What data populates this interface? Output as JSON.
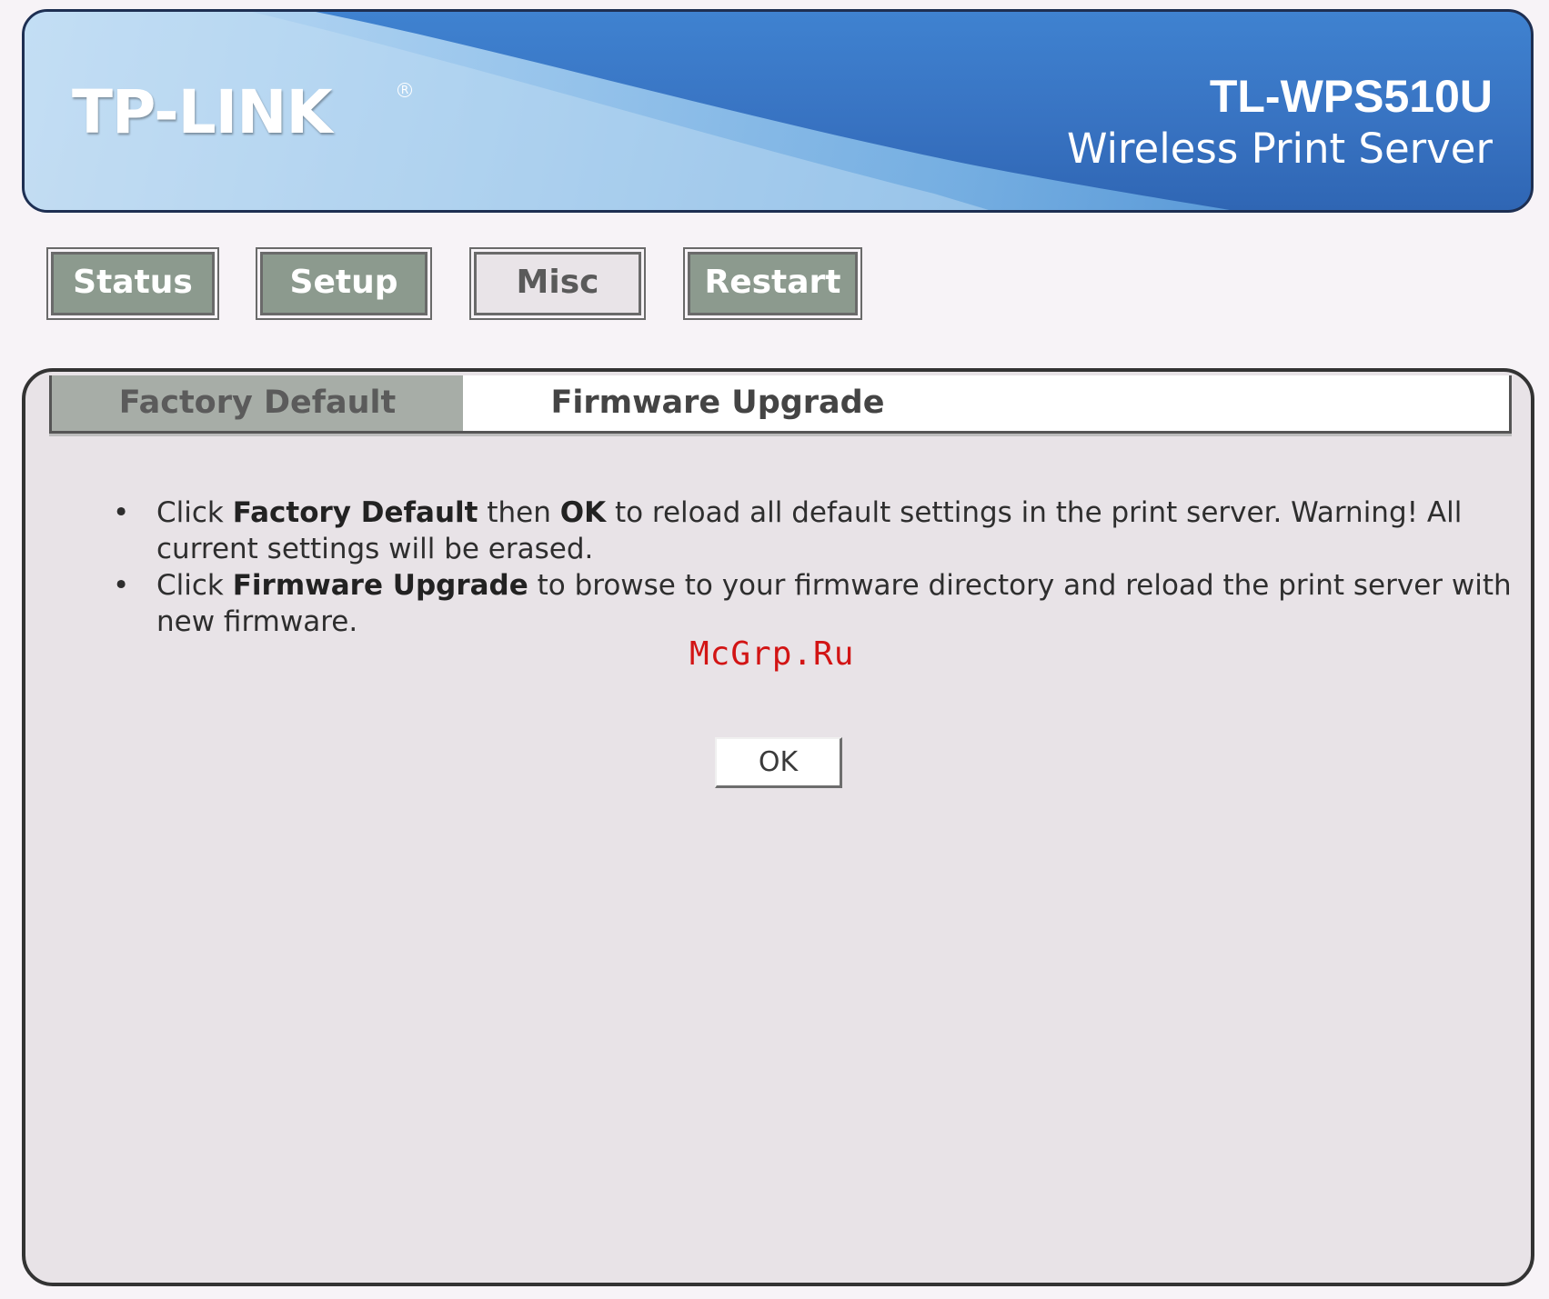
{
  "header": {
    "logo_text": "TP-LINK",
    "logo_mark": "R",
    "model": "TL-WPS510U",
    "product": "Wireless Print Server"
  },
  "nav": {
    "status_label": "Status",
    "setup_label": "Setup",
    "misc_label": "Misc",
    "restart_label": "Restart",
    "active": "Misc"
  },
  "tabs": {
    "factory_default_label": "Factory Default",
    "firmware_upgrade_label": "Firmware Upgrade",
    "selected": "Factory Default"
  },
  "instructions": {
    "bullet": "•",
    "item1": {
      "p1": "Click ",
      "b1": "Factory Default",
      "p2": " then ",
      "b2": "OK",
      "p3": " to reload all default settings in the print server. Warning! All current settings will be erased."
    },
    "item2": {
      "p1": "Click ",
      "b1": "Firmware Upgrade",
      "p2": " to browse to your firmware directory and reload the print server with new firmware."
    }
  },
  "watermark": "McGrp.Ru",
  "ok_label": "OK",
  "colors": {
    "header_blue": "#3873c2",
    "nav_inactive": "#8c9a8e",
    "panel_bg": "#e8e3e7",
    "watermark_red": "#d21414"
  }
}
